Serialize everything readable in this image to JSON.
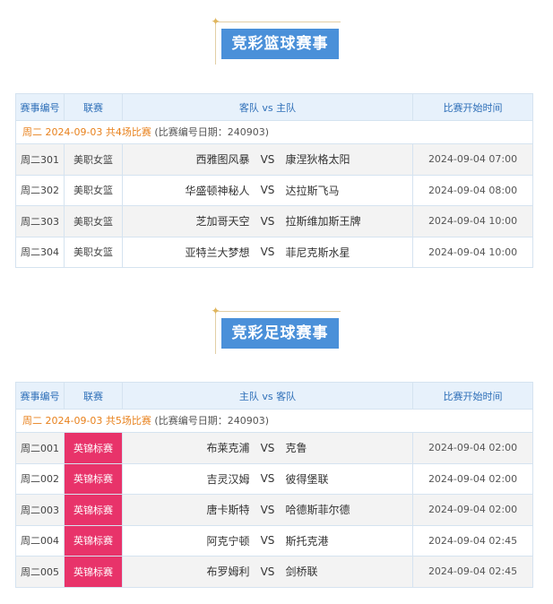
{
  "basketball": {
    "title": "竞彩篮球赛事",
    "headers": [
      "赛事编号",
      "联赛",
      "客队 vs 主队",
      "比赛开始时间"
    ],
    "date_prefix": "周二 2024-09-03 共4场比赛",
    "date_suffix": "(比赛编号日期：240903)",
    "rows": [
      {
        "id": "周二301",
        "league": "美职女篮",
        "home": "西雅图风暴",
        "vs": "VS",
        "away": "康涅狄格太阳",
        "time": "2024-09-04 07:00"
      },
      {
        "id": "周二302",
        "league": "美职女篮",
        "home": "华盛顿神秘人",
        "vs": "VS",
        "away": "达拉斯飞马",
        "time": "2024-09-04 08:00"
      },
      {
        "id": "周二303",
        "league": "美职女篮",
        "home": "芝加哥天空",
        "vs": "VS",
        "away": "拉斯维加斯王牌",
        "time": "2024-09-04 10:00"
      },
      {
        "id": "周二304",
        "league": "美职女篮",
        "home": "亚特兰大梦想",
        "vs": "VS",
        "away": "菲尼克斯水星",
        "time": "2024-09-04 10:00"
      }
    ]
  },
  "football": {
    "title": "竞彩足球赛事",
    "headers": [
      "赛事编号",
      "联赛",
      "主队 vs 客队",
      "比赛开始时间"
    ],
    "date_prefix": "周二 2024-09-03 共5场比赛",
    "date_suffix": "(比赛编号日期：240903)",
    "rows": [
      {
        "id": "周二001",
        "league": "英锦标赛",
        "home": "布莱克浦",
        "vs": "VS",
        "away": "克鲁",
        "time": "2024-09-04 02:00"
      },
      {
        "id": "周二002",
        "league": "英锦标赛",
        "home": "吉灵汉姆",
        "vs": "VS",
        "away": "彼得堡联",
        "time": "2024-09-04 02:00"
      },
      {
        "id": "周二003",
        "league": "英锦标赛",
        "home": "唐卡斯特",
        "vs": "VS",
        "away": "哈德斯菲尔德",
        "time": "2024-09-04 02:00"
      },
      {
        "id": "周二004",
        "league": "英锦标赛",
        "home": "阿克宁顿",
        "vs": "VS",
        "away": "斯托克港",
        "time": "2024-09-04 02:45"
      },
      {
        "id": "周二005",
        "league": "英锦标赛",
        "home": "布罗姆利",
        "vs": "VS",
        "away": "剑桥联",
        "time": "2024-09-04 02:45"
      }
    ]
  },
  "colors": {
    "accent_blue": "#4a90d9",
    "league_pink": "#e8336a",
    "date_orange": "#e8811c"
  },
  "icons": {
    "banner": "star-icon"
  }
}
